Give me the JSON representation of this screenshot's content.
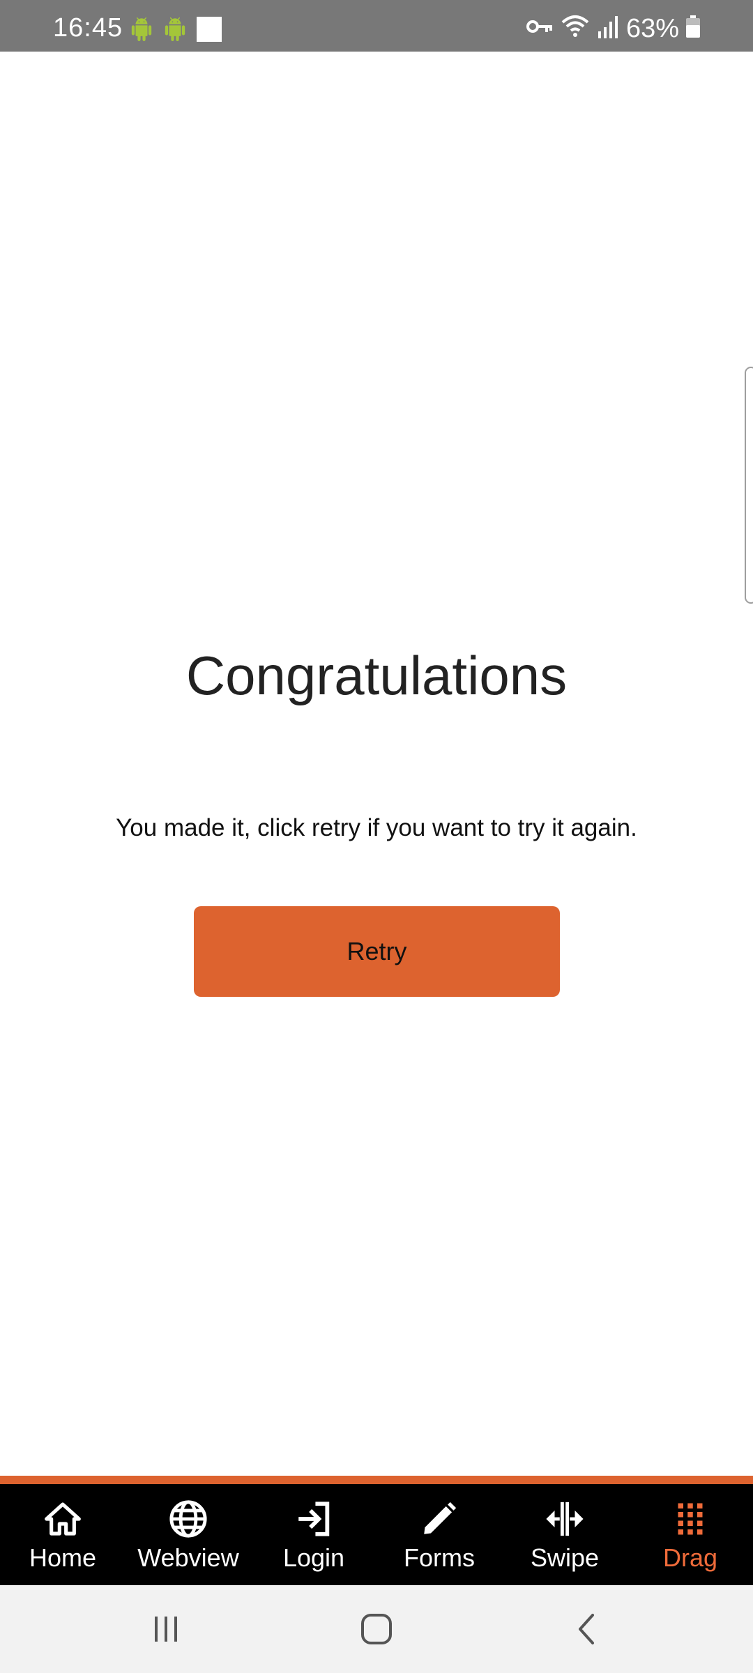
{
  "status_bar": {
    "time": "16:45",
    "battery": "63%",
    "icons": [
      "android-icon",
      "android-icon",
      "square-notification-icon",
      "key-icon",
      "wifi-icon",
      "signal-icon",
      "battery-icon"
    ]
  },
  "main": {
    "title": "Congratulations",
    "message": "You made it, click retry if you want to try it again.",
    "retry_label": "Retry"
  },
  "tabs": [
    {
      "label": "Home",
      "icon": "home-icon"
    },
    {
      "label": "Webview",
      "icon": "globe-icon"
    },
    {
      "label": "Login",
      "icon": "login-icon"
    },
    {
      "label": "Forms",
      "icon": "pencil-icon"
    },
    {
      "label": "Swipe",
      "icon": "swipe-icon"
    },
    {
      "label": "Drag",
      "icon": "drag-grid-icon",
      "active": true
    }
  ],
  "colors": {
    "accent": "#dd632f",
    "active_tab": "#ef6b3a",
    "status_bar": "#787878",
    "tab_bar": "#000000",
    "nav_bar": "#f2f2f2"
  },
  "nav_bar": {
    "buttons": [
      "recent-apps-icon",
      "home-nav-icon",
      "back-icon"
    ]
  }
}
